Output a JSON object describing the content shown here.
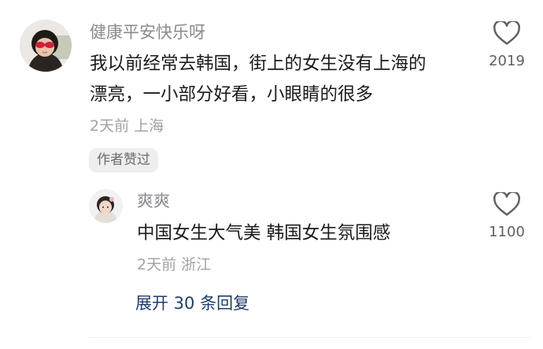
{
  "comments": [
    {
      "username": "健康平安快乐呀",
      "text_line1": "我以前经常去韩国，街上的女生没有上海的",
      "text_line2": "漂亮，一小部分好看，小眼睛的很多",
      "time": "2天前",
      "location": "上海",
      "likes": "2019",
      "badge": "作者赞过"
    },
    {
      "username": "爽爽",
      "text": "中国女生大气美 韩国女生氛围感",
      "time": "2天前",
      "location": "浙江",
      "likes": "1100"
    }
  ],
  "expand_label": "展开 30 条回复",
  "icons": {
    "like": "heart-outline-icon"
  }
}
